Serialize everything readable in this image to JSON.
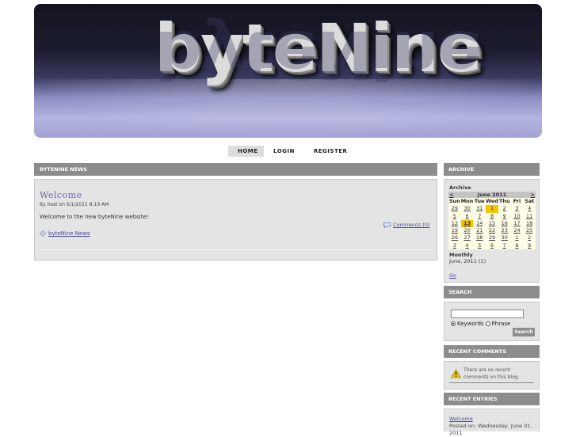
{
  "banner": {
    "logo_text": "byteNine"
  },
  "nav": {
    "items": [
      {
        "label": "HOME",
        "active": true
      },
      {
        "label": "LOGIN",
        "active": false
      },
      {
        "label": "REGISTER",
        "active": false
      }
    ]
  },
  "main": {
    "header": "BYTENINE NEWS",
    "post": {
      "title": "Welcome",
      "meta": "By host on 6/1/2011 8:19 AM",
      "body": "Welcome to the new byteNine website!",
      "comments_link": "Comments (0)",
      "category_link": "byteNine News"
    }
  },
  "archive": {
    "header": "ARCHIVE",
    "label": "Archive",
    "prev": "<",
    "month_title": "June 2011",
    "next": ">",
    "day_names": [
      "Sun",
      "Mon",
      "Tue",
      "Wed",
      "Thu",
      "Fri",
      "Sat"
    ],
    "weeks": [
      [
        "29",
        "30",
        "31",
        "1",
        "2",
        "3",
        "4"
      ],
      [
        "5",
        "6",
        "7",
        "8",
        "9",
        "10",
        "11"
      ],
      [
        "12",
        "13",
        "14",
        "15",
        "16",
        "17",
        "18"
      ],
      [
        "19",
        "20",
        "21",
        "22",
        "23",
        "24",
        "25"
      ],
      [
        "26",
        "27",
        "28",
        "29",
        "30",
        "1",
        "2"
      ],
      [
        "3",
        "4",
        "5",
        "6",
        "7",
        "8",
        "9"
      ]
    ],
    "highlighted_day": "1",
    "today": "13",
    "monthly_label": "Monthly",
    "monthly_item": "June, 2011 (1)",
    "go_label": "Go"
  },
  "search": {
    "header": "SEARCH",
    "input_value": "",
    "option_keywords": "Keywords",
    "option_phrase": "Phrase",
    "selected_option": "Keywords",
    "button_label": "Search"
  },
  "recent_comments": {
    "header": "RECENT COMMENTS",
    "message": "There are no recent comments on this blog."
  },
  "recent_entries": {
    "header": "RECENT ENTRIES",
    "entry_title": "Welcome",
    "entry_posted": "Posted on: Wednesday, June 01, 2011"
  },
  "colors": {
    "panel_header": "#8c8c8c",
    "panel_body": "#e4e4e4",
    "link": "#4a4aa0",
    "calendar_highlight": "#f4c400"
  }
}
